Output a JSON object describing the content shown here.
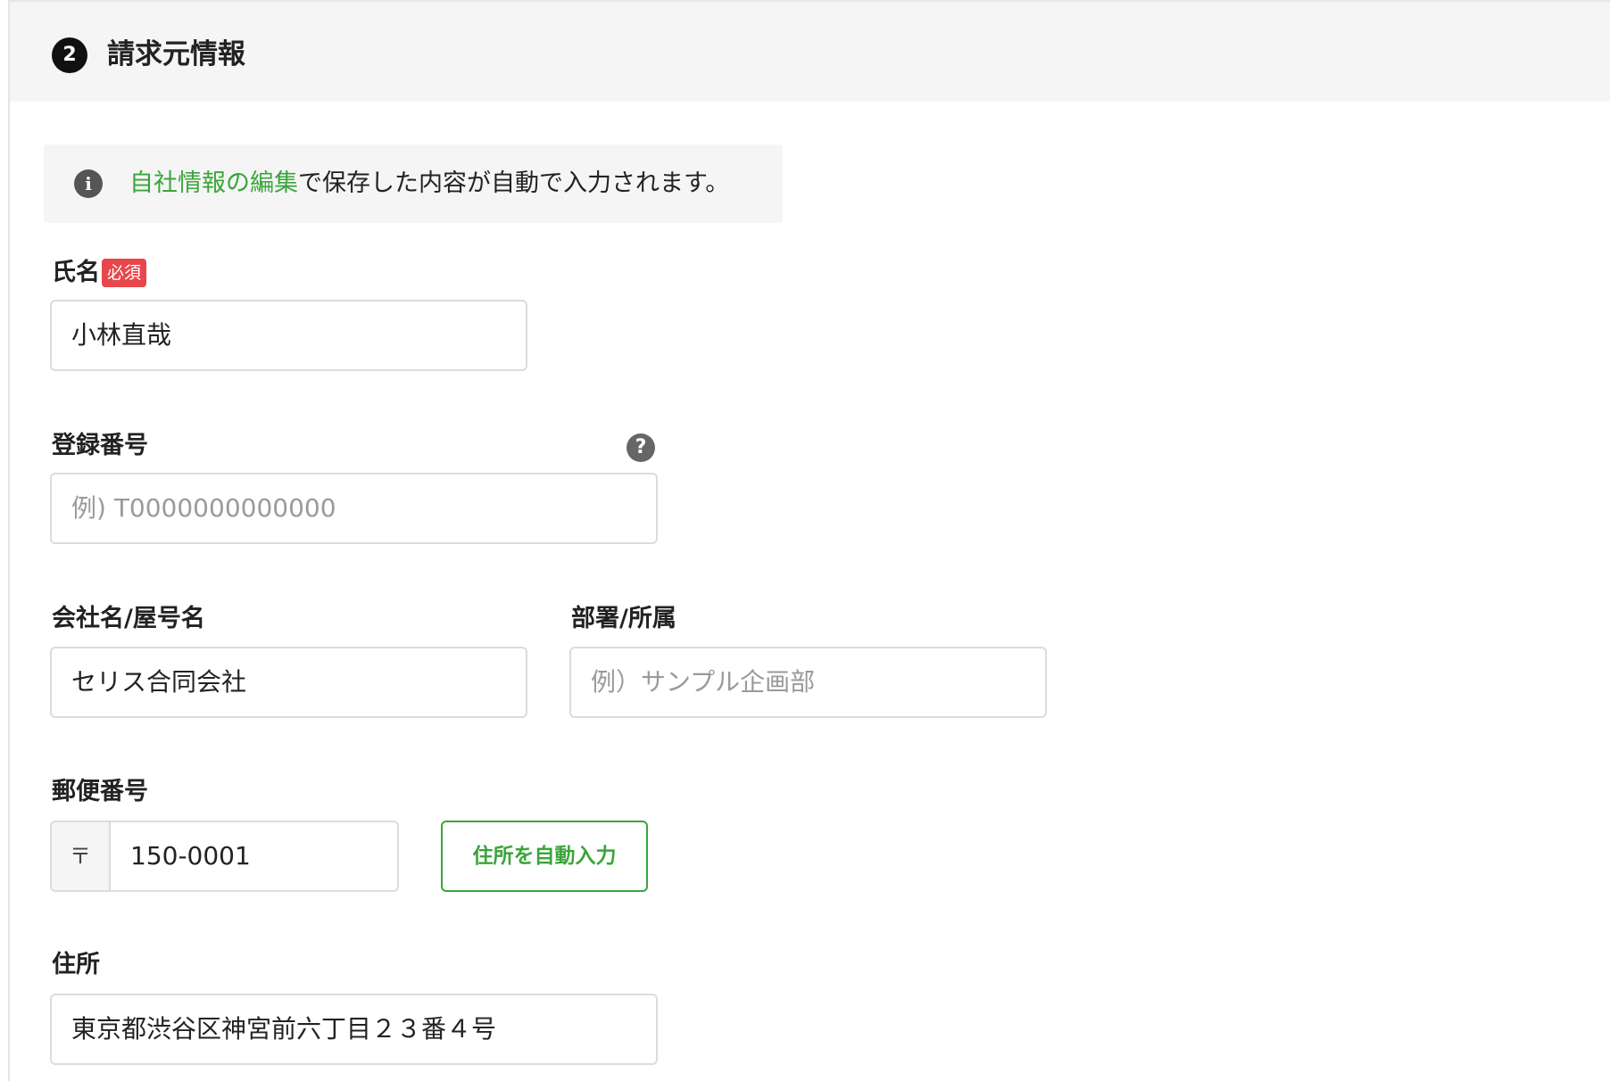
{
  "section": {
    "step_number": "2",
    "title": "請求元情報"
  },
  "info": {
    "link_text": "自社情報の編集",
    "text": "で保存した内容が自動で入力されます。"
  },
  "fields": {
    "name": {
      "label": "氏名",
      "required_badge": "必須",
      "value": "小林直哉"
    },
    "registration_number": {
      "label": "登録番号",
      "placeholder": "例) T0000000000000"
    },
    "company": {
      "label": "会社名/屋号名",
      "value": "セリス合同会社"
    },
    "department": {
      "label": "部署/所属",
      "placeholder": "例）サンプル企画部"
    },
    "postal_code": {
      "label": "郵便番号",
      "prefix": "〒",
      "value": "150-0001",
      "auto_fill_button": "住所を自動入力"
    },
    "address": {
      "label": "住所",
      "value": "東京都渋谷区神宮前六丁目２３番４号"
    }
  },
  "colors": {
    "accent_green": "#3aa53a",
    "required_red": "#e8474b"
  },
  "icons": {
    "info": "info-icon",
    "help": "help-icon"
  }
}
